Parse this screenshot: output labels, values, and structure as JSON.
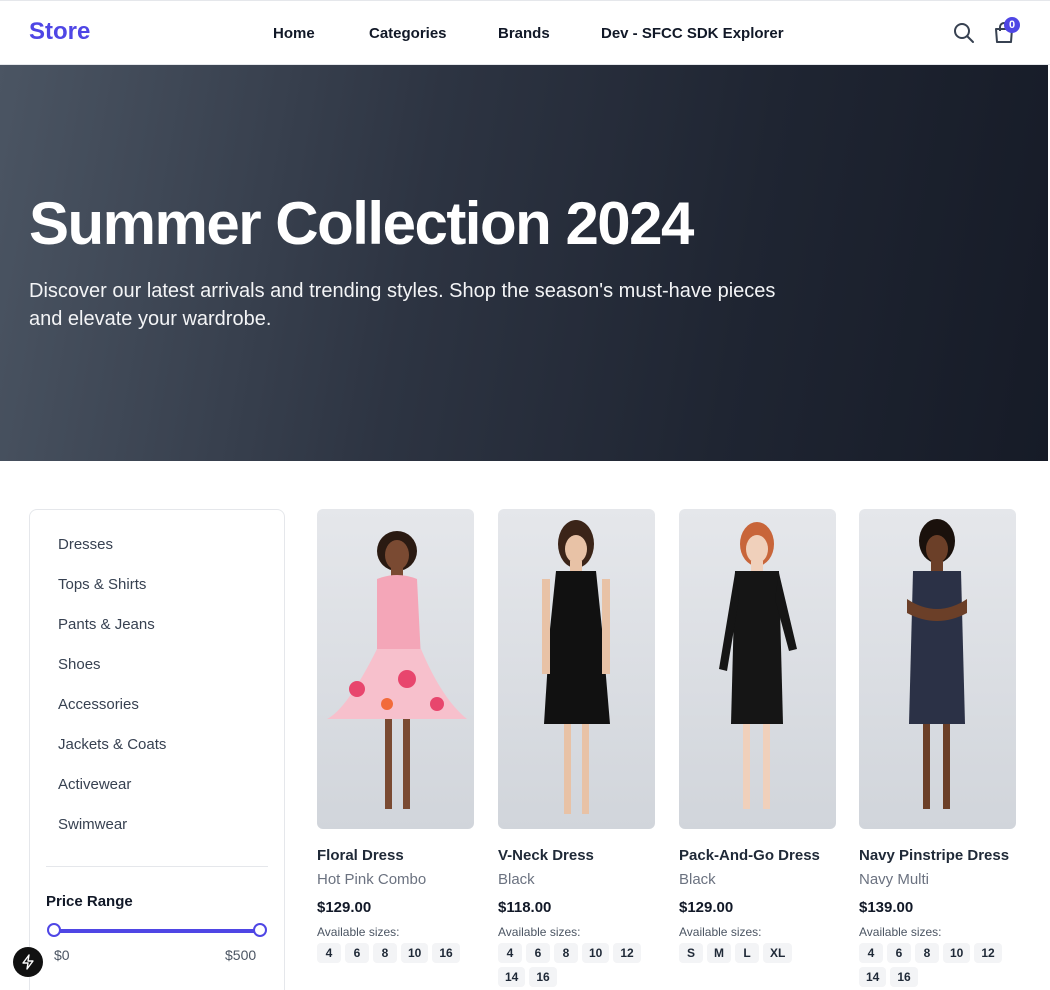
{
  "header": {
    "logo": "Store",
    "nav": [
      "Home",
      "Categories",
      "Brands",
      "Dev - SFCC SDK Explorer"
    ],
    "cart_count": "0",
    "search_icon": "search-icon",
    "cart_icon": "shopping-bag-icon"
  },
  "hero": {
    "title": "Summer Collection 2024",
    "subtitle": "Discover our latest arrivals and trending styles. Shop the season's must-have pieces and elevate your wardrobe."
  },
  "sidebar": {
    "categories": [
      "Dresses",
      "Tops & Shirts",
      "Pants & Jeans",
      "Shoes",
      "Accessories",
      "Jackets & Coats",
      "Activewear",
      "Swimwear"
    ],
    "price_range_label": "Price Range",
    "price_min": "$0",
    "price_max": "$500"
  },
  "products": [
    {
      "name": "Floral Dress",
      "color": "Hot Pink Combo",
      "price": "$129.00",
      "sizes_label": "Available sizes:",
      "sizes": [
        "4",
        "6",
        "8",
        "10",
        "16"
      ],
      "dress_color": "#f4a6b8"
    },
    {
      "name": "V-Neck Dress",
      "color": "Black",
      "price": "$118.00",
      "sizes_label": "Available sizes:",
      "sizes": [
        "4",
        "6",
        "8",
        "10",
        "12",
        "14",
        "16"
      ],
      "dress_color": "#111111"
    },
    {
      "name": "Pack-And-Go Dress",
      "color": "Black",
      "price": "$129.00",
      "sizes_label": "Available sizes:",
      "sizes": [
        "S",
        "M",
        "L",
        "XL"
      ],
      "dress_color": "#151515"
    },
    {
      "name": "Navy Pinstripe Dress",
      "color": "Navy Multi",
      "price": "$139.00",
      "sizes_label": "Available sizes:",
      "sizes": [
        "4",
        "6",
        "8",
        "10",
        "12",
        "14",
        "16"
      ],
      "dress_color": "#2b3146"
    }
  ],
  "colors": {
    "accent": "#4f46e5",
    "hero_dark": "#161b27"
  }
}
